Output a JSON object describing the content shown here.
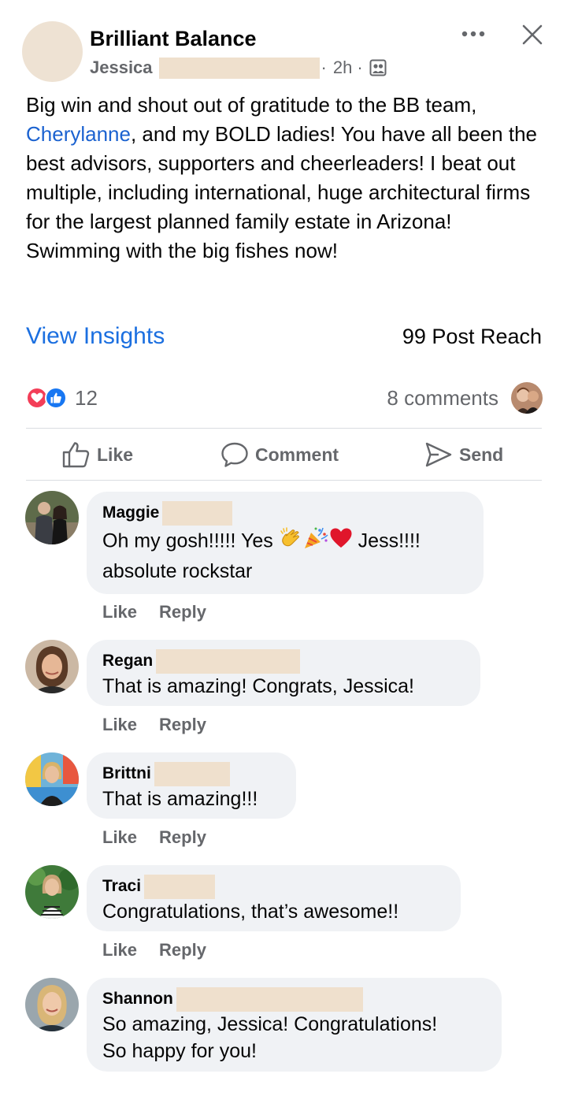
{
  "post": {
    "group_name": "Brilliant Balance",
    "author": "Jessica",
    "time": "2h",
    "separator": "·",
    "text_before_mention": "Big win and shout out of gratitude to the BB team, ",
    "mention": "Cherylanne",
    "text_after_mention": ", and my BOLD ladies! You have all been the best advisors, supporters and cheerleaders! I beat out multiple, including international, huge architectural firms for the largest planned family estate in Arizona! Swimming with the big fishes now!"
  },
  "insights": {
    "view_insights_label": "View Insights",
    "post_reach": "99 Post Reach"
  },
  "reactions": {
    "count": "12",
    "comments": "8 comments"
  },
  "actions": {
    "like": "Like",
    "comment": "Comment",
    "send": "Send"
  },
  "comments": [
    {
      "name": "Maggie",
      "text_line1": "Oh my gosh!!!!! Yes ",
      "text_after_emoji": " Jess!!!!",
      "text_line2": "absolute rockstar",
      "like": "Like",
      "reply": "Reply"
    },
    {
      "name": "Regan",
      "text": "That is amazing!  Congrats, Jessica!",
      "like": "Like",
      "reply": "Reply"
    },
    {
      "name": "Brittni",
      "text": "That is amazing!!!",
      "like": "Like",
      "reply": "Reply"
    },
    {
      "name": "Traci",
      "text": "Congratulations, that’s awesome!!",
      "like": "Like",
      "reply": "Reply"
    },
    {
      "name": "Shannon",
      "text_line1": "So amazing, Jessica! Congratulations!",
      "text_line2": "So happy for you!"
    }
  ],
  "colors": {
    "link_blue": "#1b6fe0",
    "mention_blue": "#1b62d0",
    "bubble_gray": "#f0f2f5",
    "meta_gray": "#65676b",
    "love_red": "#f33e58",
    "like_blue": "#1877f2",
    "redaction": "#efe0cd"
  },
  "icons": [
    "more-icon",
    "close-icon",
    "audience-icon",
    "love-reaction-icon",
    "like-reaction-icon",
    "like-icon",
    "comment-icon",
    "send-icon",
    "clap-emoji",
    "party-emoji",
    "heart-emoji"
  ]
}
